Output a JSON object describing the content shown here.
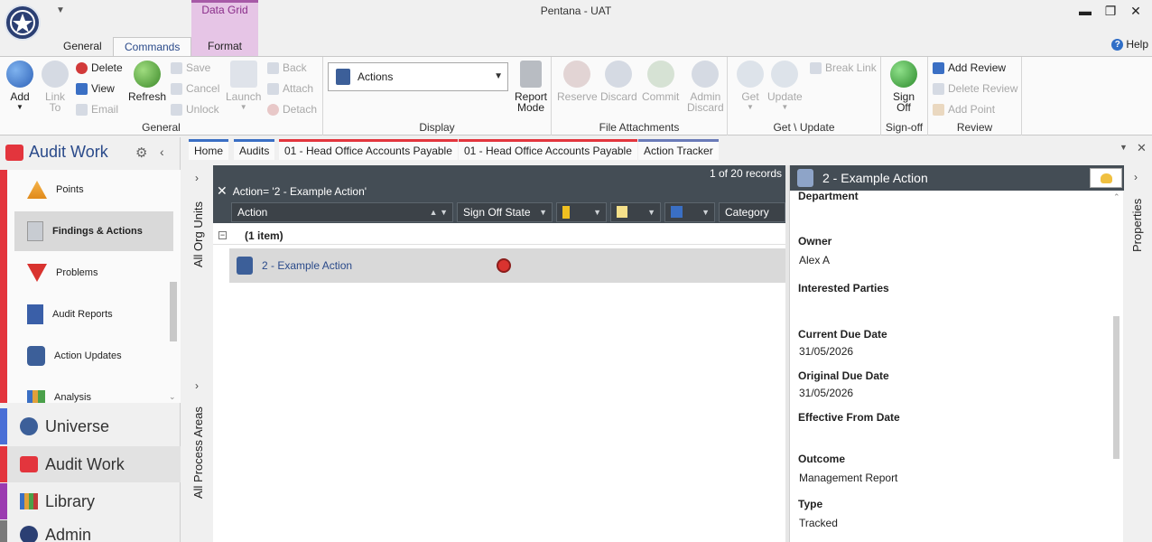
{
  "window": {
    "title": "Pentana - UAT",
    "minimize": "▬",
    "maximize": "❐",
    "close": "✕"
  },
  "quick_access": {
    "arrow": "▼"
  },
  "ribbon": {
    "context_group": "Data Grid",
    "tabs": [
      "General",
      "Commands",
      "Format"
    ],
    "help": "Help",
    "groups": {
      "general": {
        "label": "General",
        "add": "Add",
        "link_to": "Link\nTo",
        "delete": "Delete",
        "view": "View",
        "email": "Email",
        "refresh": "Refresh"
      },
      "save": {
        "save": "Save",
        "cancel": "Cancel",
        "unlock": "Unlock",
        "launch": "Launch",
        "back": "Back",
        "attach": "Attach",
        "detach": "Detach"
      },
      "display": {
        "label": "Display",
        "combo_value": "Actions",
        "report_mode": "Report\nMode"
      },
      "file_attachments": {
        "label": "File Attachments",
        "reserve": "Reserve",
        "discard": "Discard",
        "commit": "Commit",
        "admin_discard": "Admin\nDiscard"
      },
      "get_update": {
        "label": "Get \\ Update",
        "get": "Get",
        "update": "Update",
        "break_link": "Break Link"
      },
      "signoff": {
        "label": "Sign-off",
        "sign_off": "Sign\nOff"
      },
      "review": {
        "label": "Review",
        "add_review": "Add Review",
        "delete_review": "Delete Review",
        "add_point": "Add Point"
      }
    }
  },
  "leftnav": {
    "title": "Audit Work",
    "items": [
      {
        "label": "Points"
      },
      {
        "label": "Findings & Actions"
      },
      {
        "label": "Problems"
      },
      {
        "label": "Audit Reports"
      },
      {
        "label": "Action Updates"
      },
      {
        "label": "Analysis"
      }
    ],
    "sections": [
      {
        "label": "Universe"
      },
      {
        "label": "Audit Work"
      },
      {
        "label": "Library"
      },
      {
        "label": "Admin"
      }
    ]
  },
  "strips": {
    "org_units": "All Org Units",
    "process_areas": "All Process Areas",
    "properties": "Properties"
  },
  "doctabs": [
    {
      "label": "Home"
    },
    {
      "label": "Audits"
    },
    {
      "label": "01 - Head Office Accounts Payable"
    },
    {
      "label": "01 - Head Office Accounts Payable"
    },
    {
      "label": "Action Tracker"
    }
  ],
  "grid": {
    "record_count": "1 of 20 records",
    "filter": "Action= '2 - Example Action'",
    "columns": [
      "Action",
      "Sign Off State",
      "",
      "",
      "",
      "Category"
    ],
    "group": "(1 item)",
    "row": {
      "action": "2 - Example Action"
    }
  },
  "detail": {
    "title": "2 - Example Action",
    "fields": [
      {
        "label": "Department",
        "value": ""
      },
      {
        "label": "Owner",
        "value": "Alex A"
      },
      {
        "label": "Interested Parties",
        "value": ""
      },
      {
        "label": "Current Due Date",
        "value": "31/05/2026"
      },
      {
        "label": "Original Due Date",
        "value": "31/05/2026"
      },
      {
        "label": "Effective From Date",
        "value": ""
      },
      {
        "label": "Outcome",
        "value": "Management Report"
      },
      {
        "label": "Type",
        "value": "Tracked"
      }
    ]
  },
  "colors": {
    "accent_blue": "#2a4a8a",
    "audit_red": "#e3353d",
    "universe_blue": "#4a6fd6",
    "library_purple": "#9b3bb0",
    "admin_gray": "#7a7a7a",
    "header_dark": "#444d55"
  }
}
